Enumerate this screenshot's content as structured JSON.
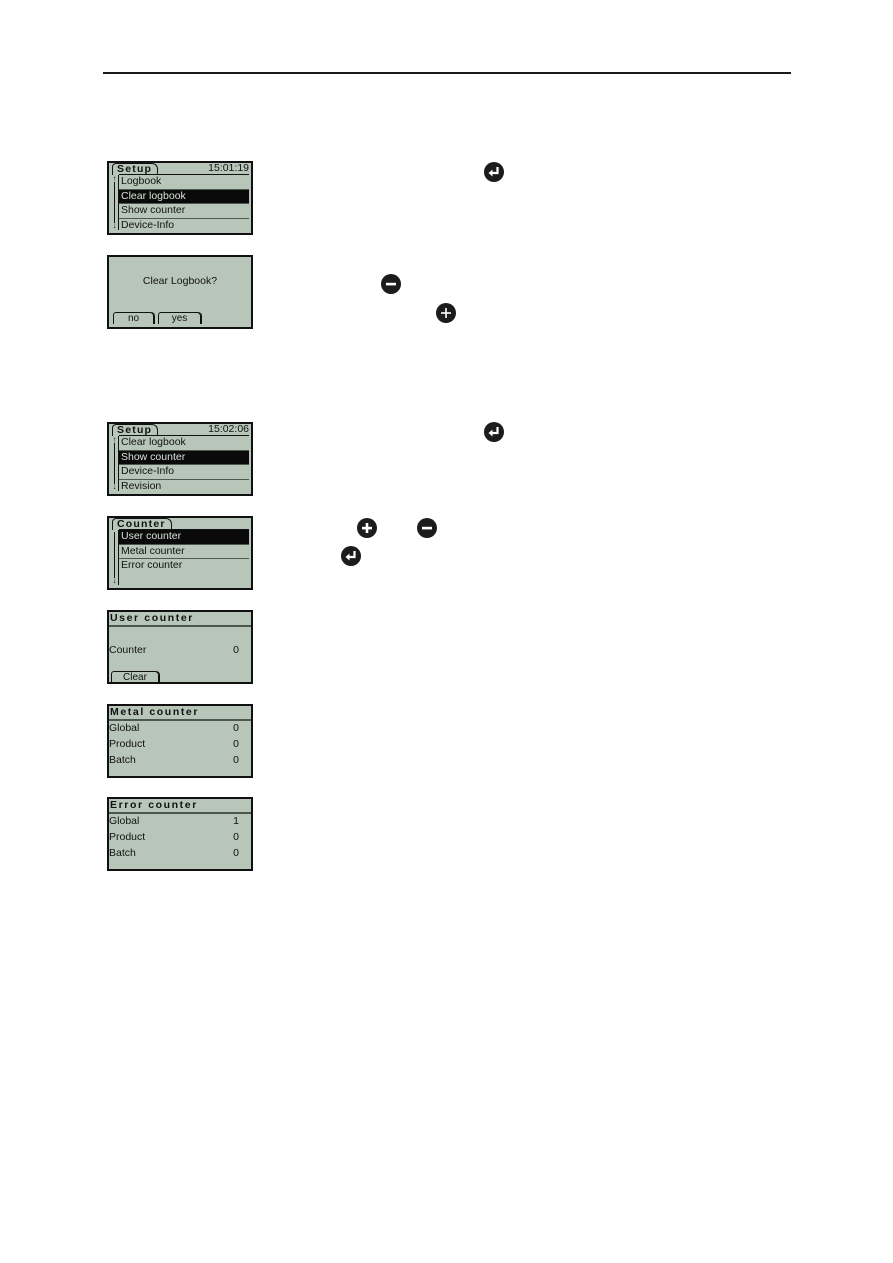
{
  "screens": {
    "setup1": {
      "tab": "Setup",
      "clock": "15:01:19",
      "items": [
        "Logbook",
        "Clear logbook",
        "Show counter",
        "Device-Info"
      ],
      "selected": "Clear logbook"
    },
    "confirm": {
      "message": "Clear Logbook?",
      "no_label": "no",
      "yes_label": "yes"
    },
    "setup2": {
      "tab": "Setup",
      "clock": "15:02:06",
      "items": [
        "Clear logbook",
        "Show counter",
        "Device-Info",
        "Revision"
      ],
      "selected": "Show counter"
    },
    "counter_menu": {
      "tab": "Counter",
      "items": [
        "User counter",
        "Metal counter",
        "Error counter"
      ],
      "selected": "User counter"
    },
    "user_counter": {
      "title": "User counter",
      "rows": [
        {
          "label": "Counter",
          "value": "0"
        }
      ],
      "clear_label": "Clear"
    },
    "metal_counter": {
      "title": "Metal counter",
      "rows": [
        {
          "label": "Global",
          "value": "0"
        },
        {
          "label": "Product",
          "value": "0"
        },
        {
          "label": "Batch",
          "value": "0"
        }
      ]
    },
    "error_counter": {
      "title": "Error counter",
      "rows": [
        {
          "label": "Global",
          "value": "1"
        },
        {
          "label": "Product",
          "value": "0"
        },
        {
          "label": "Batch",
          "value": "0"
        }
      ]
    }
  },
  "icons": {
    "enter": "enter-key-icon",
    "minus": "minus-key-icon",
    "plus": "plus-key-icon"
  },
  "colors": {
    "lcd_background": "#b8c6ba",
    "lcd_foreground": "#111111",
    "icon_fill": "#1c1c1c"
  }
}
